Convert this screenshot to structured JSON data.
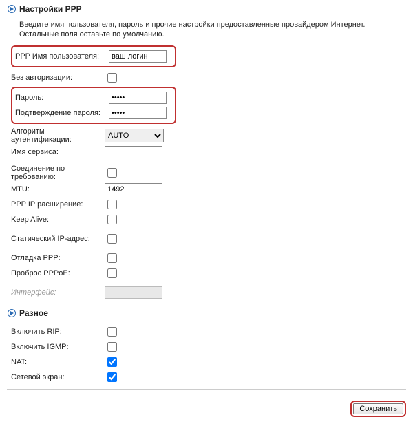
{
  "section_ppp": {
    "icon": "arrow-right",
    "title": "Настройки PPP",
    "intro": "Введите имя пользователя, пароль и прочие настройки предоставленные провайдером Интернет. Остальные поля оставьте по умолчанию.",
    "fields": {
      "username": {
        "label": "PPP Имя пользователя:",
        "value": "ваш логин"
      },
      "noauth": {
        "label": "Без авторизации:",
        "checked": false
      },
      "password": {
        "label": "Пароль:",
        "value": "•••••"
      },
      "password_confirm": {
        "label": "Подтверждение пароля:",
        "value": "•••••"
      },
      "auth_algo": {
        "label": "Алгоритм аутентификации:",
        "value": "AUTO"
      },
      "service_name": {
        "label": "Имя сервиса:",
        "value": ""
      },
      "on_demand": {
        "label": "Соединение по требованию:",
        "checked": false
      },
      "mtu": {
        "label": "MTU:",
        "value": "1492"
      },
      "ip_ext": {
        "label": "PPP IP расширение:",
        "checked": false
      },
      "keep_alive": {
        "label": "Keep Alive:",
        "checked": false
      },
      "static_ip": {
        "label": "Статический IP-адрес:",
        "checked": false
      },
      "debug_ppp": {
        "label": "Отладка PPP:",
        "checked": false
      },
      "pppoe_relay": {
        "label": "Проброс PPPoE:",
        "checked": false
      },
      "interface": {
        "label": "Интерфейс:"
      }
    }
  },
  "section_misc": {
    "icon": "arrow-right",
    "title": "Разное",
    "fields": {
      "rip": {
        "label": "Включить RIP:",
        "checked": false
      },
      "igmp": {
        "label": "Включить IGMP:",
        "checked": false
      },
      "nat": {
        "label": "NAT:",
        "checked": true
      },
      "fw": {
        "label": "Сетевой экран:",
        "checked": true
      }
    }
  },
  "footer": {
    "save_label": "Сохранить"
  },
  "colors": {
    "highlight": "#c03030"
  }
}
